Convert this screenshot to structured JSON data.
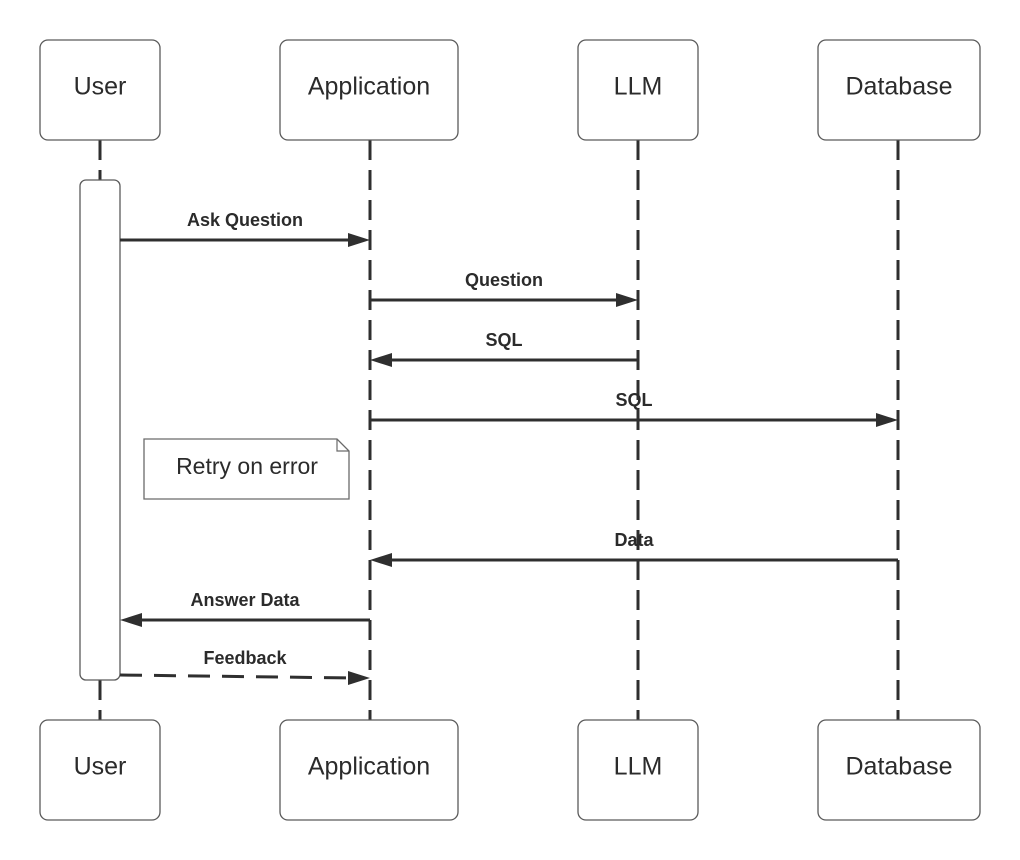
{
  "diagram": {
    "type": "sequence",
    "actors": [
      {
        "id": "user",
        "label": "User"
      },
      {
        "id": "app",
        "label": "Application"
      },
      {
        "id": "llm",
        "label": "LLM"
      },
      {
        "id": "db",
        "label": "Database"
      }
    ],
    "messages": [
      {
        "from": "user",
        "to": "app",
        "label": "Ask Question",
        "style": "solid"
      },
      {
        "from": "app",
        "to": "llm",
        "label": "Question",
        "style": "solid"
      },
      {
        "from": "llm",
        "to": "app",
        "label": "SQL",
        "style": "solid"
      },
      {
        "from": "app",
        "to": "db",
        "label": "SQL",
        "style": "solid"
      },
      {
        "from": "db",
        "to": "app",
        "label": "Data",
        "style": "solid"
      },
      {
        "from": "app",
        "to": "user",
        "label": "Answer Data",
        "style": "solid"
      },
      {
        "from": "user",
        "to": "app",
        "label": "Feedback",
        "style": "dashed"
      }
    ],
    "note": {
      "text": "Retry on error"
    },
    "activation": {
      "actor": "user"
    }
  }
}
